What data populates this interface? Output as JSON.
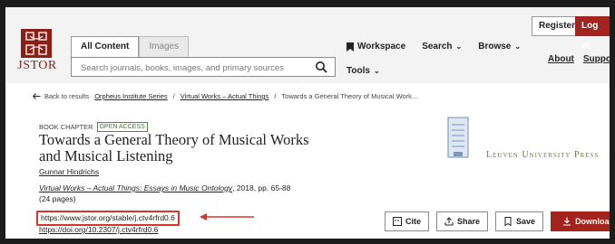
{
  "header": {
    "logo_text": "JSTOR",
    "search_tabs": [
      "All Content",
      "Images"
    ],
    "search": {
      "placeholder": "Search journals, books, images, and primary sources"
    },
    "nav": {
      "workspace": "Workspace",
      "search": "Search",
      "browse": "Browse",
      "tools": "Tools"
    },
    "register": "Register",
    "login": "Log in",
    "about": "About",
    "support": "Support"
  },
  "breadcrumb": {
    "back": "Back to results",
    "series": "Orpheus Institute Series",
    "book": "Virtual Works – Actual Things",
    "current": "Towards a General Theory of Musical Work..."
  },
  "chapter": {
    "type_label": "BOOK CHAPTER",
    "access_badge": "OPEN ACCESS",
    "title": "Towards a General Theory of Musical Works and Musical Listening",
    "author": "Gunnar Hindrichs",
    "book_title": "Virtual Works – Actual Things: Essays in Music Ontology",
    "source_rest": ", 2018, pp. 65-88",
    "pages": "(24 pages)",
    "stable_url": "https://www.jstor.org/stable/j.ctv4rfrd0.6",
    "doi": "https://doi.org/10.2307/j.ctv4rfrd0.6"
  },
  "publisher": {
    "name": "Leuven University Press"
  },
  "actions": {
    "cite": "Cite",
    "share": "Share",
    "save": "Save",
    "download": "Download"
  },
  "colors": {
    "brand": "#a3241c",
    "annotation": "#d9342b",
    "badge": "#3b7a2f"
  }
}
